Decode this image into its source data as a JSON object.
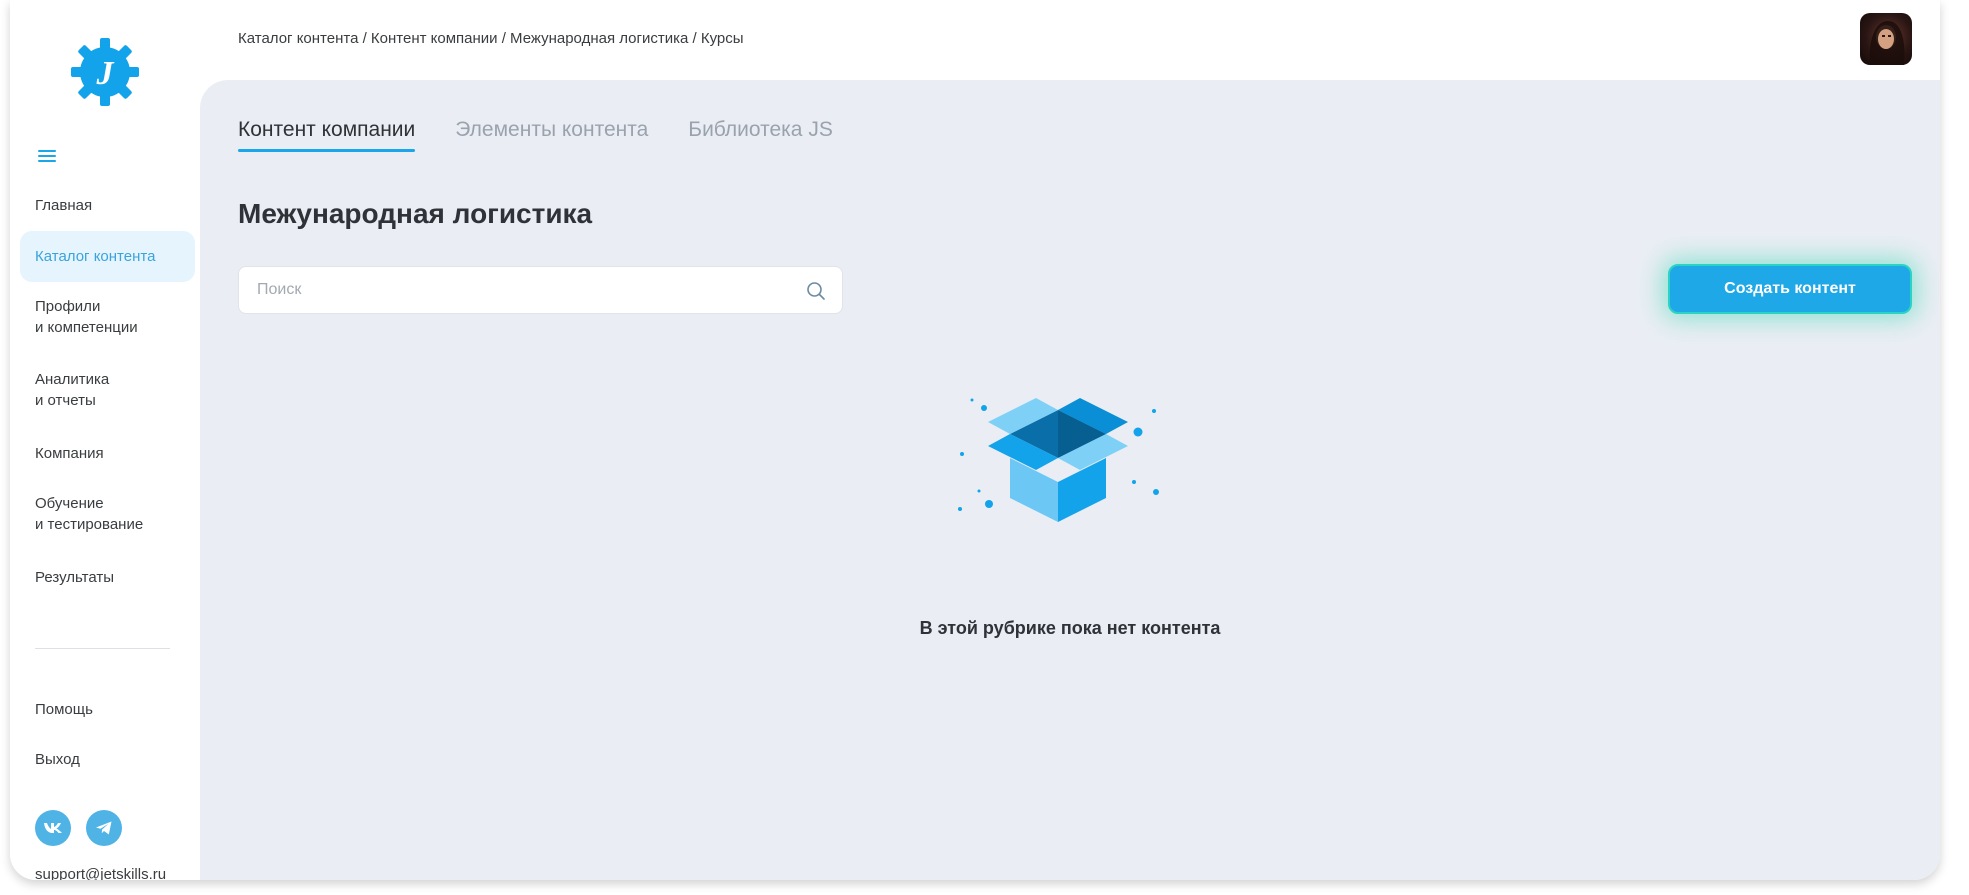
{
  "breadcrumb": "Каталог контента / Контент компании / Межународная логистика / Курсы",
  "sidebar": {
    "items": [
      {
        "line1": "Главная",
        "line2": ""
      },
      {
        "line1": "Каталог контента",
        "line2": ""
      },
      {
        "line1": "Профили",
        "line2": "и компетенции"
      },
      {
        "line1": "Аналитика",
        "line2": "и отчеты"
      },
      {
        "line1": "Компания",
        "line2": ""
      },
      {
        "line1": "Обучение",
        "line2": "и тестирование"
      },
      {
        "line1": "Результаты",
        "line2": ""
      }
    ],
    "help": "Помощь",
    "logout": "Выход",
    "email": "support@jetskills.ru"
  },
  "tabs": [
    "Контент компании",
    "Элементы контента",
    "Библиотека JS"
  ],
  "page_title": "Межународная логистика",
  "search": {
    "placeholder": "Поиск",
    "value": ""
  },
  "create_button": "Создать контент",
  "empty_message": "В этой рубрике пока нет контента",
  "colors": {
    "accent": "#1aa6e8",
    "active_bg": "#e5f4fd",
    "panel_bg": "#eaeef4",
    "glow": "#2ad3c4"
  },
  "icons": {
    "logo": "gear-j-logo",
    "menu": "hamburger-icon",
    "search": "search-icon",
    "vk": "vk-icon",
    "telegram": "telegram-icon",
    "empty": "open-box-illustration"
  }
}
